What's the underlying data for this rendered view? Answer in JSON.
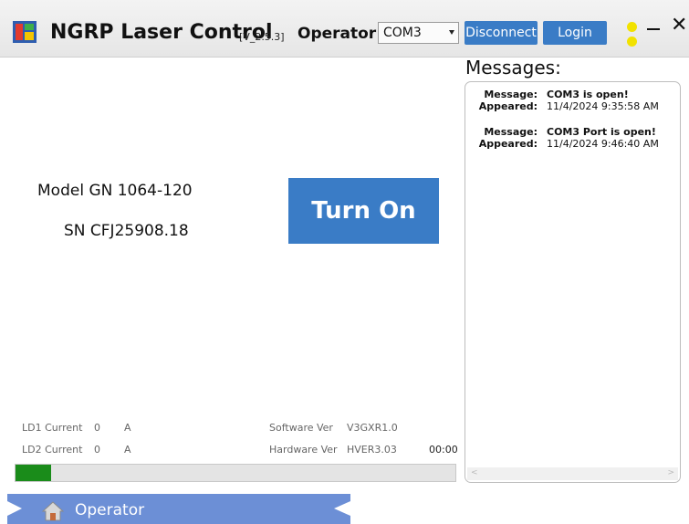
{
  "titlebar": {
    "app_title": "NGRP Laser Control",
    "version": "[V_2.5.3]",
    "role": "Operator",
    "port_selected": "COM3",
    "disconnect_label": "Disconnect",
    "login_label": "Login",
    "close_glyph": "✕",
    "logo_icon": "app-logo-icon",
    "status_color": "#f2e200"
  },
  "device": {
    "model": "Model GN 1064-120",
    "serial": "SN CFJ25908.18",
    "power_button": "Turn On",
    "accent_color": "#3a7cc6"
  },
  "messages": {
    "title": "Messages:",
    "items": [
      {
        "message_label": "Message:",
        "message": "COM3 is open!",
        "appeared_label": "Appeared:",
        "appeared": "11/4/2024 9:35:58 AM"
      },
      {
        "message_label": "Message:",
        "message": "COM3 Port is open!",
        "appeared_label": "Appeared:",
        "appeared": "11/4/2024 9:46:40 AM"
      }
    ]
  },
  "status": {
    "ld1_label": "LD1 Current",
    "ld1_value": "0",
    "ld1_unit": "A",
    "ld2_label": "LD2 Current",
    "ld2_value": "0",
    "ld2_unit": "A",
    "software_label": "Software Ver",
    "software_value": "V3GXR1.0",
    "hardware_label": "Hardware Ver",
    "hardware_value": "HVER3.03",
    "timer": "00:00",
    "progress_fraction": 0.08,
    "progress_color": "#1a8c1a"
  },
  "nav": {
    "label": "Operator",
    "icon": "home-icon"
  }
}
